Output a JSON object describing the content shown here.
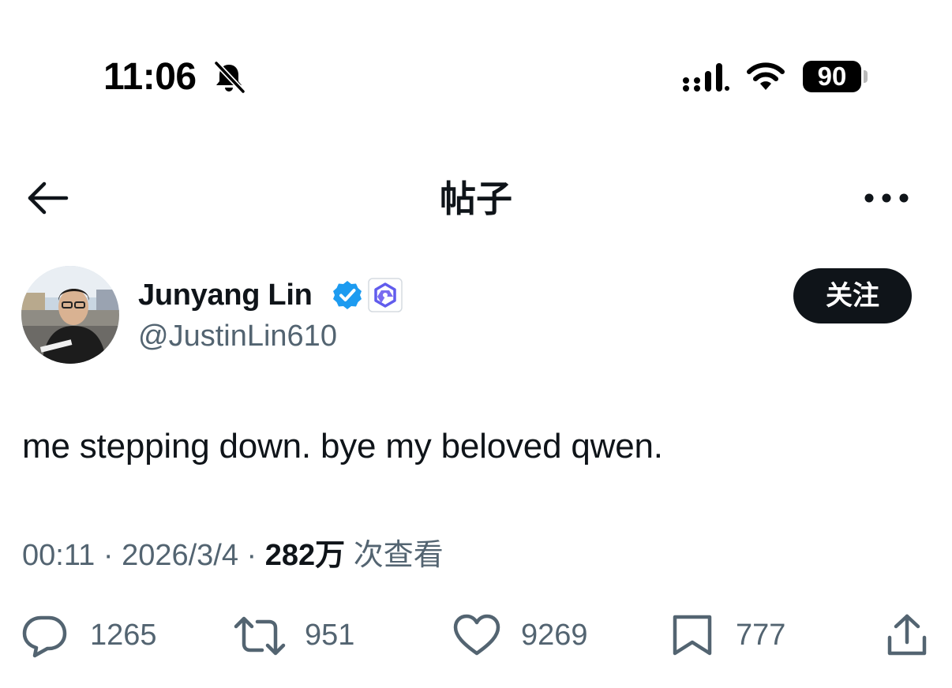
{
  "status_bar": {
    "time": "11:06",
    "battery": "90"
  },
  "header": {
    "title": "帖子"
  },
  "author": {
    "name": "Junyang Lin",
    "handle": "@JustinLin610",
    "follow_label": "关注"
  },
  "tweet": {
    "text": "me stepping down. bye my beloved qwen."
  },
  "meta": {
    "time": "00:11",
    "separator": "·",
    "date": "2026/3/4",
    "views": "282万",
    "views_label": "次查看"
  },
  "actions": {
    "replies": "1265",
    "reposts": "951",
    "likes": "9269",
    "bookmarks": "777"
  },
  "colors": {
    "text_primary": "#0f1419",
    "text_secondary": "#536471",
    "verified_blue": "#1d9bf0",
    "follow_bg": "#0f1419"
  }
}
